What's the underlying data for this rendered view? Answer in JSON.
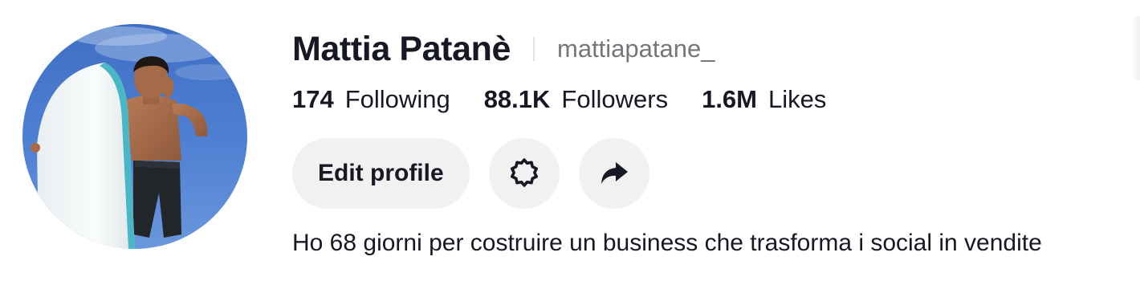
{
  "profile": {
    "display_name": "Mattia Patanè",
    "username": "mattiapatane_",
    "avatar_alt": "profile photo"
  },
  "stats": [
    {
      "value": "174",
      "label": "Following"
    },
    {
      "value": "88.1K",
      "label": "Followers"
    },
    {
      "value": "1.6M",
      "label": "Likes"
    }
  ],
  "actions": {
    "edit_profile_label": "Edit profile",
    "settings_icon": "gear-icon",
    "share_icon": "share-arrow-icon"
  },
  "bio": "Ho 68 giorni per costruire un business che trasforma i social in vendite",
  "colors": {
    "text_primary": "#161823",
    "text_secondary": "#75767b",
    "button_bg": "#f1f1f2",
    "divider": "#e3e3e4"
  }
}
